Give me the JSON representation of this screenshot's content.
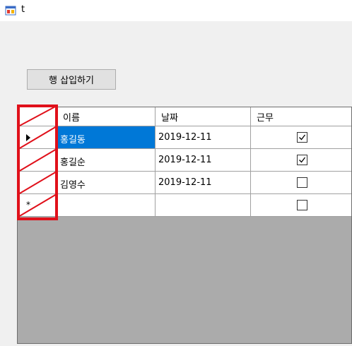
{
  "window": {
    "title": "t"
  },
  "toolbar": {
    "insert_row_label": "행 삽입하기"
  },
  "grid": {
    "columns": [
      "이름",
      "날짜",
      "근무"
    ],
    "rows": [
      {
        "name": "홍길동",
        "date": "2019-12-11",
        "work": true,
        "current": true
      },
      {
        "name": "홍길순",
        "date": "2019-12-11",
        "work": true,
        "current": false
      },
      {
        "name": "김영수",
        "date": "2019-12-11",
        "work": false,
        "current": false
      }
    ],
    "new_row": {
      "marker": "*",
      "work": false
    }
  },
  "colors": {
    "selection": "#0078d7",
    "annotation": "#e0101a",
    "empty_area": "#ababab"
  }
}
